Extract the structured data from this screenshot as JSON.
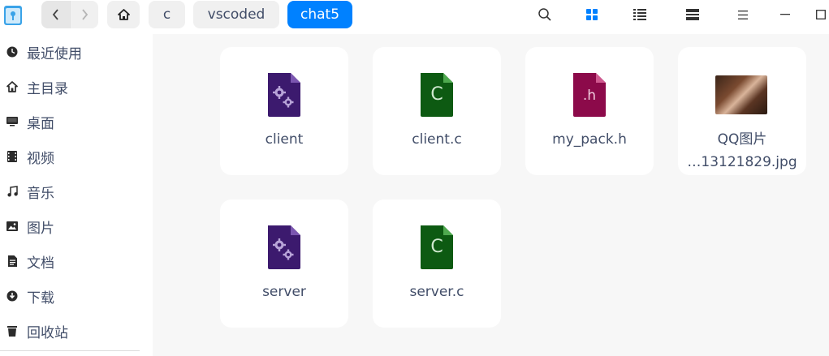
{
  "breadcrumbs": [
    "c",
    "vscoded",
    "chat5"
  ],
  "sidebar": {
    "items": [
      {
        "label": "最近使用",
        "icon": "clock-icon"
      },
      {
        "label": "主目录",
        "icon": "home-icon"
      },
      {
        "label": "桌面",
        "icon": "desktop-icon"
      },
      {
        "label": "视频",
        "icon": "video-icon"
      },
      {
        "label": "音乐",
        "icon": "music-icon"
      },
      {
        "label": "图片",
        "icon": "picture-icon"
      },
      {
        "label": "文档",
        "icon": "document-icon"
      },
      {
        "label": "下载",
        "icon": "download-icon"
      },
      {
        "label": "回收站",
        "icon": "trash-icon"
      }
    ]
  },
  "files": [
    {
      "name": "client",
      "type": "executable",
      "icon_letter": ""
    },
    {
      "name": "client.c",
      "type": "c-source",
      "icon_letter": "C"
    },
    {
      "name": "my_pack.h",
      "type": "c-header",
      "icon_letter": ".h"
    },
    {
      "name_line1": "QQ图片",
      "name_line2": "…13121829.jpg",
      "type": "image"
    },
    {
      "name": "server",
      "type": "executable",
      "icon_letter": ""
    },
    {
      "name": "server.c",
      "type": "c-source",
      "icon_letter": "C"
    }
  ],
  "colors": {
    "accent": "#0081ff",
    "executable": "#3c1a6e",
    "c_source": "#0d5a12",
    "c_header": "#8c0a4a"
  }
}
